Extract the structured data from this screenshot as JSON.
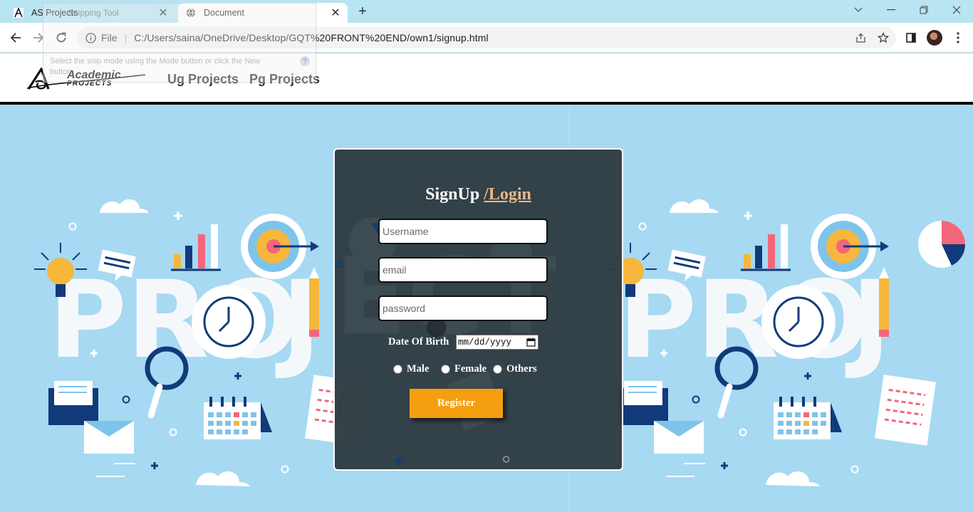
{
  "browser": {
    "tabs": [
      {
        "title": "AS Projects",
        "active": false,
        "favicon": "academic-logo-icon"
      },
      {
        "title": "Document",
        "active": true,
        "favicon": "globe-icon"
      }
    ],
    "new_tab_icon": "plus-icon",
    "address": {
      "scheme_label": "File",
      "url": "C:/Users/saina/OneDrive/Desktop/GQT%20FRONT%20END/own1/signup.html"
    },
    "snipping_tool_ghost": {
      "title": "Snipping Tool",
      "hint": "Select the snip mode using the Mode button or click the New button."
    }
  },
  "site": {
    "logo_text_top": "Academic",
    "logo_text_bottom": "PROJECTS",
    "nav": [
      "Ug Projects",
      "Pg Projects"
    ]
  },
  "form": {
    "title": "SignUp ",
    "login_link": "/Login",
    "username_placeholder": "Username",
    "email_placeholder": "email",
    "password_placeholder": "password",
    "dob_label": "Date Of Birth",
    "dob_placeholder": "mm/dd/yyyy",
    "genders": [
      "Male",
      "Female",
      "Others"
    ],
    "submit_label": "Register"
  },
  "colors": {
    "hero_bg": "#a7d9f3",
    "card_bg": "#2f3c42",
    "accent_button": "#f49e10",
    "login_link": "#e8b888",
    "tabstrip": "#b9e4f1"
  }
}
